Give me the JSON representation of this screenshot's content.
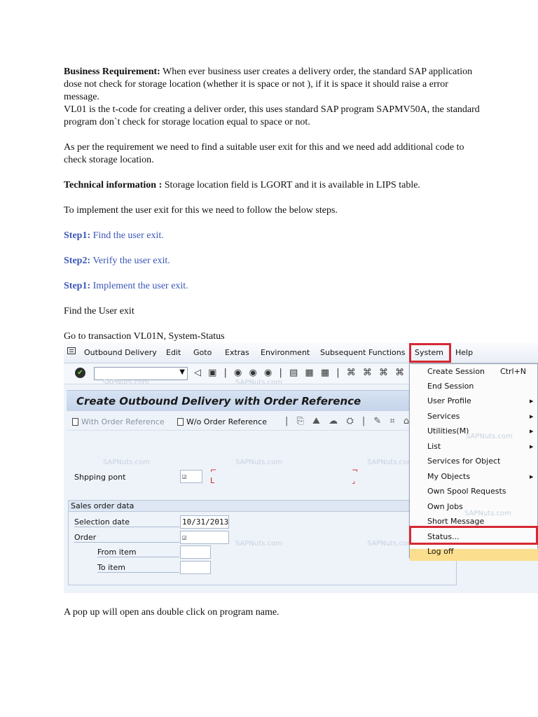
{
  "doc": {
    "br_label": "Business Requirement:",
    "br_text": " When ever business user creates a delivery order, the standard SAP application dose not check for storage location (whether it is space or not ), if it is space it should raise a error message.",
    "vl01_text": "VL01 is the t-code for creating a deliver order, this uses standard SAP program SAPMV50A, the standard program don`t check for storage location equal to space or not.",
    "requirement_text": "As per the requirement we need to find a suitable user exit for this and we need add additional code to check storage location.",
    "tech_label": "Technical information :",
    "tech_text": " Storage location field is LGORT and it is available in LIPS table.",
    "implement_text": "To implement the user exit for this we need to follow the below steps.",
    "step1_label": "Step1:",
    "step1_text": " Find the user exit.",
    "step2_label": "Step2:",
    "step2_text": " Verify the user exit.",
    "step3_label": "Step1:",
    "step3_text": " Implement the user exit.",
    "find_text": "Find the User exit",
    "goto_text": "Go to transaction VL01N, System-Status",
    "caption": "A pop up will open ans double click on program name."
  },
  "sap": {
    "menubar": {
      "outbound_delivery": "Outbound Delivery",
      "edit": "Edit",
      "goto": "Goto",
      "extras": "Extras",
      "environment": "Environment",
      "subsequent_functions": "Subsequent Functions",
      "system": "System",
      "help": "Help"
    },
    "title": "Create Outbound Delivery with Order Reference",
    "app_toolbar": {
      "with_order_ref": "With Order Reference",
      "wo_order_ref": "W/o Order Reference"
    },
    "form": {
      "shipping_point_label": "Shpping pont",
      "sales_order_data": "Sales order data",
      "selection_date_label": "Selection date",
      "selection_date_value": "10/31/2013",
      "order_label": "Order",
      "from_item_label": "From item",
      "to_item_label": "To item"
    },
    "system_menu": [
      {
        "label": "Create Session",
        "shortcut": "Ctrl+N"
      },
      {
        "label": "End Session"
      },
      {
        "label": "User Profile",
        "submenu": true
      },
      {
        "label": "Services",
        "submenu": true
      },
      {
        "label": "Utilities(M)",
        "submenu": true
      },
      {
        "label": "List",
        "submenu": true
      },
      {
        "label": "Services for Object"
      },
      {
        "label": "My Objects",
        "submenu": true
      },
      {
        "label": "Own Spool Requests"
      },
      {
        "label": "Own Jobs"
      },
      {
        "label": "Short Message"
      },
      {
        "label": "Status..."
      },
      {
        "label": "Log off"
      }
    ],
    "watermark": "SAPNuts.com",
    "colors": {
      "highlight_box": "#d62833",
      "menu_hover": "#fbdf8e",
      "step_text": "#3b56b8"
    }
  }
}
